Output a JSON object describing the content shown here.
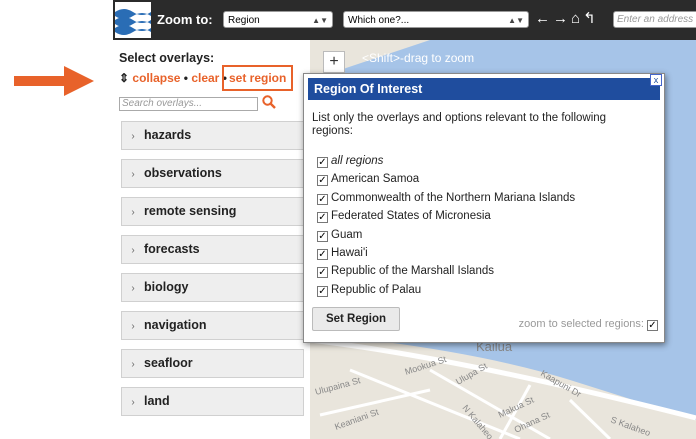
{
  "toolbar": {
    "zoom_label": "Zoom to:",
    "zoom_select_value": "Region",
    "which_select_value": "Which one?...",
    "address_placeholder": "Enter an address",
    "nav_icons": [
      "arrow-left-icon",
      "arrow-right-icon",
      "home-icon",
      "undo-icon"
    ]
  },
  "sidebar": {
    "title": "Select overlays:",
    "collapse_label": "collapse",
    "clear_label": "clear",
    "set_region_label": "set region",
    "search_placeholder": "Search overlays...",
    "categories": [
      "hazards",
      "observations",
      "remote sensing",
      "forecasts",
      "biology",
      "navigation",
      "seafloor",
      "land"
    ]
  },
  "map": {
    "zoom_in": "+",
    "drag_hint": "<Shift>-drag to zoom",
    "street_labels": [
      "Kailua",
      "Mookua St",
      "Ulupaina St",
      "Ulupa St",
      "Keaniani St",
      "Kaapuni Dr",
      "N Kalaheo",
      "Makua St",
      "Ohana St",
      "S Kalaheo"
    ]
  },
  "dialog": {
    "title": "Region Of Interest",
    "close": "x",
    "intro": "List only the overlays and options relevant to the following regions:",
    "regions": [
      "all regions",
      "American Samoa",
      "Commonwealth of the Northern Mariana Islands",
      "Federated States of Micronesia",
      "Guam",
      "Hawai'i",
      "Republic of the Marshall Islands",
      "Republic of Palau"
    ],
    "check_mark": "✓",
    "set_region_button": "Set Region",
    "zoom_to_selected_label": "zoom to selected regions:"
  },
  "colors": {
    "accent_orange": "#e8622a",
    "dialog_header": "#1f4d9e",
    "toolbar_bg": "#2b2b2b",
    "water": "#a6c4e8",
    "land": "#e9e5dc"
  }
}
